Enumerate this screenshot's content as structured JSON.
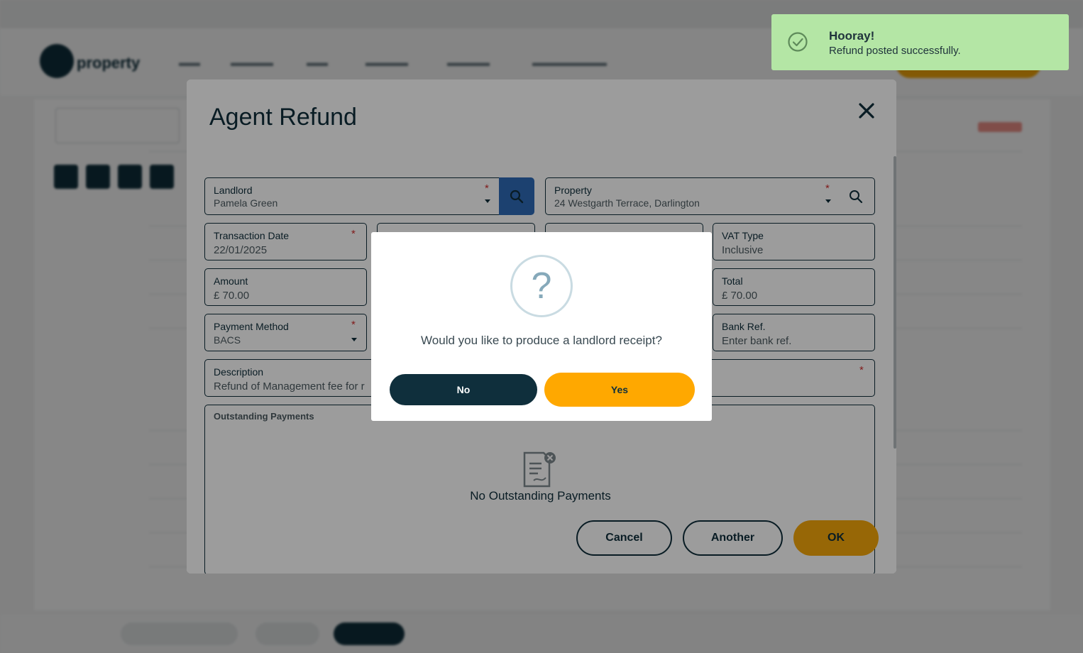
{
  "modal": {
    "title": "Agent Refund",
    "landlord": {
      "label": "Landlord",
      "value": "Pamela Green",
      "required": "*"
    },
    "property": {
      "label": "Property",
      "value": "24 Westgarth Terrace, Darlington",
      "required": "*"
    },
    "transaction_date": {
      "label": "Transaction Date",
      "value": "22/01/2025",
      "required": "*"
    },
    "vat_type": {
      "label": "VAT Type",
      "value": "Inclusive"
    },
    "amount": {
      "label": "Amount",
      "value": "£ 70.00"
    },
    "total": {
      "label": "Total",
      "value": "£ 70.00"
    },
    "payment_method": {
      "label": "Payment Method",
      "value": "BACS",
      "required": "*"
    },
    "bank_ref": {
      "label": "Bank Ref.",
      "placeholder": "Enter bank ref."
    },
    "description": {
      "label": "Description",
      "value": "Refund of Management fee for r",
      "required": "*"
    },
    "outstanding": {
      "label": "Outstanding Payments",
      "empty_text": "No Outstanding Payments"
    },
    "buttons": {
      "cancel": "Cancel",
      "another": "Another",
      "ok": "OK"
    }
  },
  "confirm": {
    "icon": "?",
    "message": "Would you like to produce a landlord receipt?",
    "no_label": "No",
    "yes_label": "Yes"
  },
  "toast": {
    "title": "Hooray!",
    "message": "Refund posted successfully."
  },
  "background": {
    "logo_text": "property"
  },
  "colors": {
    "navy": "#0f2f3c",
    "accent": "#ffa800",
    "search_blue": "#2e6ab8",
    "toast_green": "#b4e6a5",
    "required_red": "#d32f2f"
  }
}
